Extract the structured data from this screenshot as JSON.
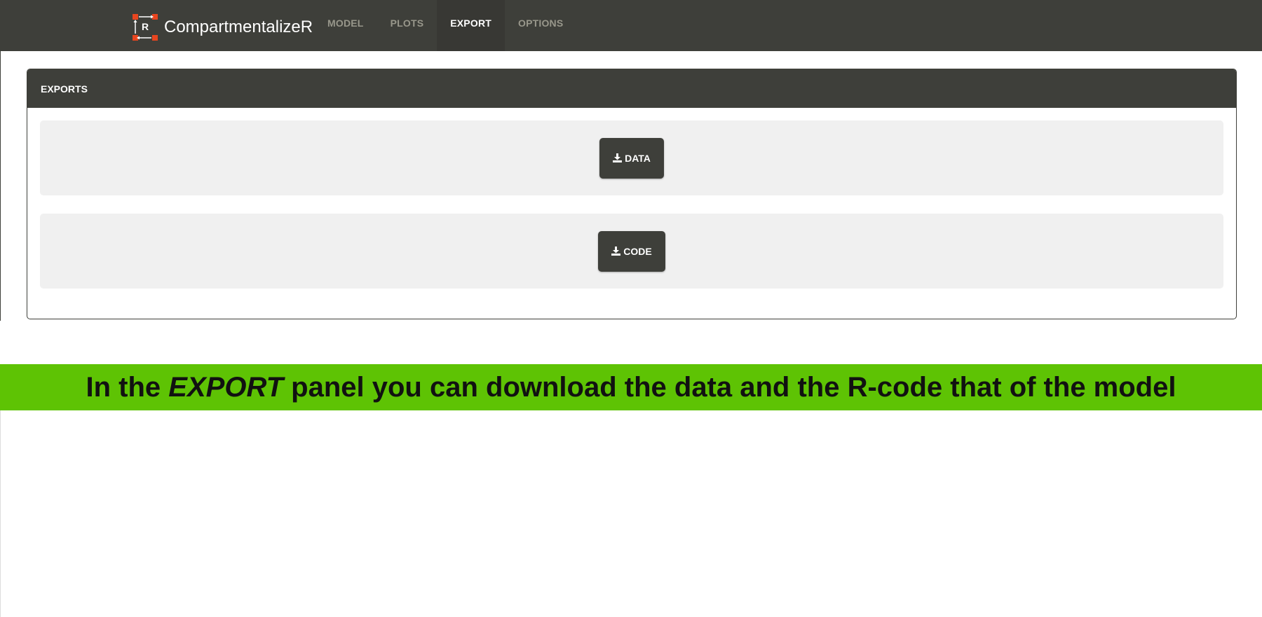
{
  "app": {
    "logo_letter": "R",
    "brand": "CompartmentalizeR"
  },
  "nav": {
    "tabs": [
      {
        "label": "MODEL",
        "active": false
      },
      {
        "label": "PLOTS",
        "active": false
      },
      {
        "label": "EXPORT",
        "active": true
      },
      {
        "label": "OPTIONS",
        "active": false
      }
    ]
  },
  "panel": {
    "title": "EXPORTS",
    "buttons": {
      "data_label": "DATA",
      "code_label": "CODE",
      "icon": "download-icon"
    }
  },
  "banner": {
    "before": "In the ",
    "emphasis": "EXPORT",
    "after": " panel you can download the data and the R-code that of the model"
  },
  "colors": {
    "navbar": "#3e3f3a",
    "accent_logo": "#e8451f",
    "banner": "#5ec304",
    "well": "#f0f0f0"
  }
}
